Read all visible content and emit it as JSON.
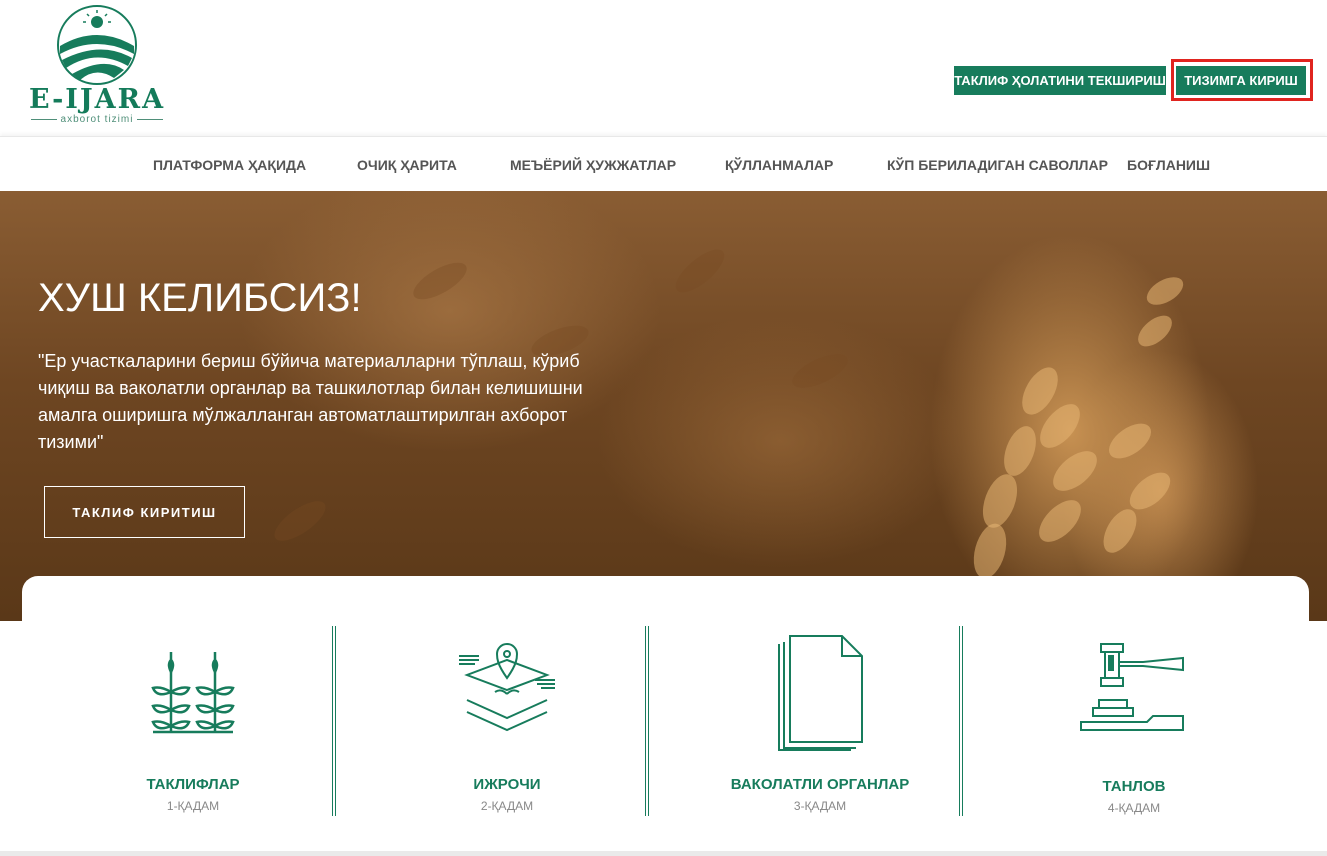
{
  "logo": {
    "name": "E-IJARA",
    "subtitle": "axborot tizimi"
  },
  "header": {
    "check_button": "ТАКЛИФ ҲОЛАТИНИ ТЕКШИРИШ",
    "login_button": "ТИЗИМГА КИРИШ"
  },
  "nav": {
    "items": [
      {
        "label": "ПЛАТФОРМА ҲАҚИДА"
      },
      {
        "label": "ОЧИҚ ҲАРИТА"
      },
      {
        "label": "МЕЪЁРИЙ ҲУЖЖАТЛАР"
      },
      {
        "label": "ҚЎЛЛАНМАЛАР"
      },
      {
        "label": "КЎП БЕРИЛАДИГАН САВОЛЛАР"
      },
      {
        "label": "БОҒЛАНИШ"
      }
    ]
  },
  "hero": {
    "title": "ХУШ КЕЛИБСИЗ!",
    "text": "\"Ер участкаларини бериш бўйича материалларни тўплаш, кўриб чиқиш ва ваколатли органлар ва ташкилотлар билан келишишни амалга оширишга мўлжалланган автоматлаштирилган ахборот тизими\"",
    "button": "ТАКЛИФ КИРИТИШ"
  },
  "steps": [
    {
      "title": "ТАКЛИФЛАР",
      "sub": "1-ҚАДАМ",
      "icon": "wheat-icon"
    },
    {
      "title": "ИЖРОЧИ",
      "sub": "2-ҚАДАМ",
      "icon": "map-pin-layers-icon"
    },
    {
      "title": "ВАКОЛАТЛИ ОРГАНЛАР",
      "sub": "3-ҚАДАМ",
      "icon": "documents-icon"
    },
    {
      "title": "ТАНЛОВ",
      "sub": "4-ҚАДАМ",
      "icon": "gavel-icon"
    }
  ],
  "colors": {
    "brand": "#177c5c",
    "highlight": "#e0241f"
  }
}
